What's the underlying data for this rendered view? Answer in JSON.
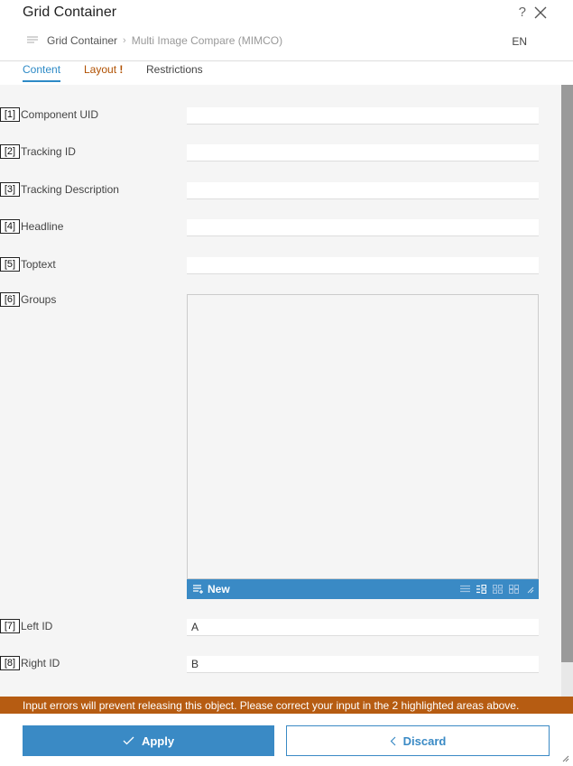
{
  "dialog": {
    "title": "Grid Container",
    "help": "?",
    "breadcrumb": {
      "first": "Grid Container",
      "second": "Multi Image Compare (MIMCO)"
    },
    "language": "EN"
  },
  "tabs": [
    {
      "label": "Content"
    },
    {
      "label": "Layout",
      "warning": "!"
    },
    {
      "label": "Restrictions"
    }
  ],
  "fields": [
    {
      "num": "[1]",
      "label": "Component UID",
      "value": ""
    },
    {
      "num": "[2]",
      "label": "Tracking ID",
      "value": ""
    },
    {
      "num": "[3]",
      "label": "Tracking Description",
      "value": ""
    },
    {
      "num": "[4]",
      "label": "Headline",
      "value": ""
    },
    {
      "num": "[5]",
      "label": "Toptext",
      "value": ""
    },
    {
      "num": "[6]",
      "label": "Groups"
    },
    {
      "num": "[7]",
      "label": "Left ID",
      "value": "A"
    },
    {
      "num": "[8]",
      "label": "Right ID",
      "value": "B"
    }
  ],
  "groups": {
    "new_label": "New"
  },
  "error": "Input errors will prevent releasing this object. Please correct your input in the 2 highlighted areas above.",
  "footer": {
    "apply": "Apply",
    "discard": "Discard"
  }
}
